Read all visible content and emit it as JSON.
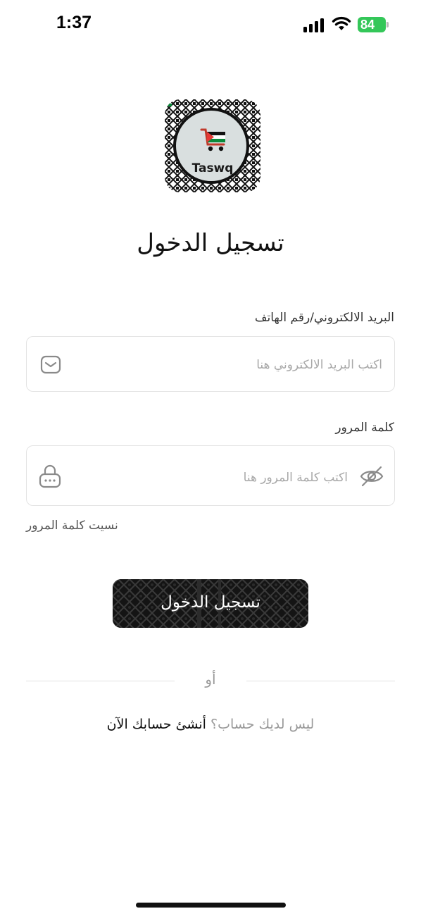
{
  "status_bar": {
    "time": "1:37",
    "battery": "84"
  },
  "logo": {
    "text": "Taswq"
  },
  "page": {
    "title": "تسجيل الدخول"
  },
  "form": {
    "email_label": "البريد الالكتروني/رقم الهاتف",
    "email_placeholder": "اكتب البريد الالكتروني هنا",
    "password_label": "كلمة المرور",
    "password_placeholder": "اكتب كلمة المرور هنا",
    "forgot_password": "نسيت كلمة المرور",
    "login_button": "تسجيل الدخول"
  },
  "divider": {
    "or_text": "أو"
  },
  "signup": {
    "question": "ليس لديك حساب؟",
    "link": "أنشئ حسابك الآن"
  },
  "icons": {
    "email": "mail-icon",
    "password": "lock-icon",
    "toggle": "eye-off-icon"
  },
  "colors": {
    "battery": "#34c759",
    "button": "#0f0f0f",
    "placeholder": "#a8a8a8"
  }
}
